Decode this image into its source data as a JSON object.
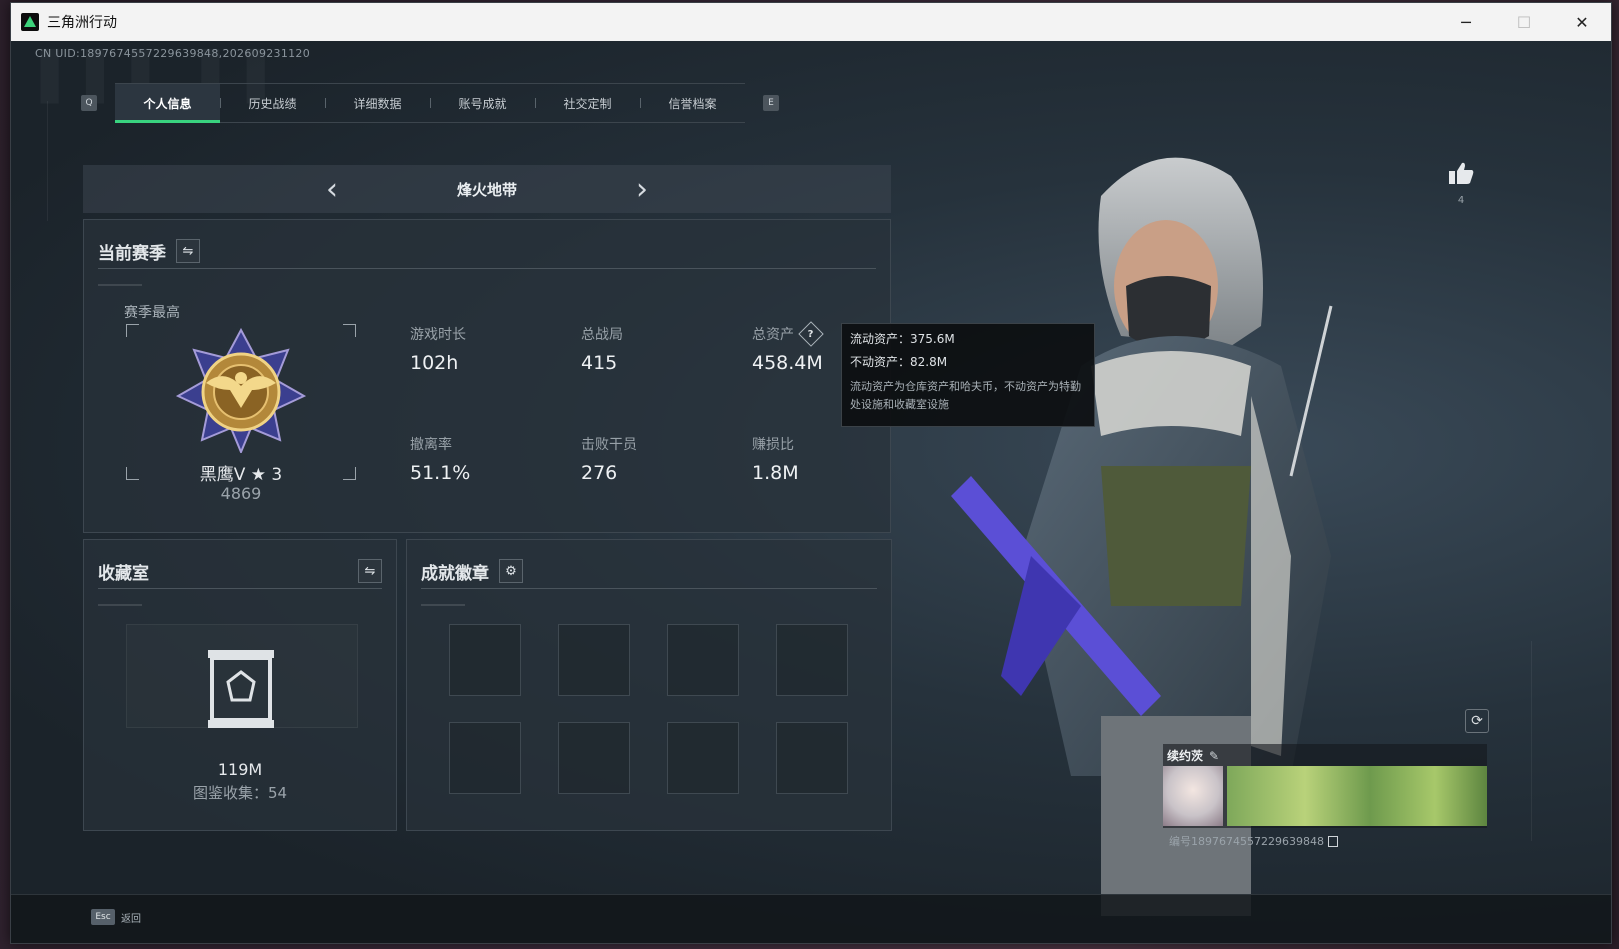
{
  "window": {
    "title": "三角洲行动"
  },
  "account": {
    "uid_line": "CN UID:1897674557229639848,202609231120"
  },
  "tabs": {
    "left_key": "Q",
    "right_key": "E",
    "items": [
      {
        "label": "个人信息",
        "active": true
      },
      {
        "label": "历史战绩",
        "active": false
      },
      {
        "label": "详细数据",
        "active": false
      },
      {
        "label": "账号成就",
        "active": false
      },
      {
        "label": "社交定制",
        "active": false
      },
      {
        "label": "信誉档案",
        "active": false
      }
    ]
  },
  "mode": {
    "title": "烽火地带"
  },
  "season": {
    "title": "当前赛季",
    "best_label": "赛季最高",
    "rank_name": "黑鹰V ★ 3",
    "rank_score": "4869",
    "stats": [
      {
        "label": "游戏时长",
        "value": "102h"
      },
      {
        "label": "总战局",
        "value": "415"
      },
      {
        "label": "总资产",
        "value": "458.4M",
        "help": true
      },
      {
        "label": "撤离率",
        "value": "51.1%"
      },
      {
        "label": "击败干员",
        "value": "276"
      },
      {
        "label": "赚损比",
        "value": "1.8M"
      }
    ]
  },
  "tooltip": {
    "liquid": "流动资产：375.6M",
    "fixed": "不动资产：82.8M",
    "desc": "流动资产为仓库资产和哈夫币，不动资产为特勤处设施和收藏室设施"
  },
  "collection": {
    "title": "收藏室",
    "value": "119M",
    "count": "图鉴收集：54"
  },
  "achievements": {
    "title": "成就徽章",
    "slots": 8
  },
  "profile": {
    "likes": "4",
    "player_name": "续约茨",
    "player_id": "编号1897674557229639848"
  },
  "footer": {
    "esc_key": "Esc",
    "back_label": "返回"
  },
  "colors": {
    "accent": "#39d37f",
    "panel": "#28323a",
    "text": "#e3e7ea"
  }
}
